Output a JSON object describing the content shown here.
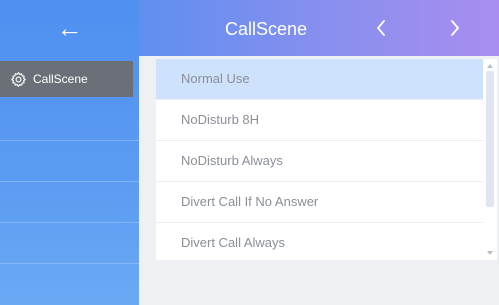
{
  "header": {
    "title": "CallScene",
    "back_glyph": "←",
    "prev_icon": "chevron-left-icon",
    "next_icon": "chevron-right-icon"
  },
  "sidebar": {
    "items": [
      {
        "label": "CallScene",
        "icon": "gear-icon",
        "selected": true
      }
    ]
  },
  "list": {
    "items": [
      {
        "label": "Normal Use",
        "selected": true
      },
      {
        "label": "NoDisturb 8H",
        "selected": false
      },
      {
        "label": "NoDisturb Always",
        "selected": false
      },
      {
        "label": "Divert Call If No Answer",
        "selected": false
      },
      {
        "label": "Divert Call Always",
        "selected": false
      }
    ]
  },
  "colors": {
    "sidebar": "#5a9bf2",
    "header_start": "#5f8ff0",
    "header_end": "#a88ef0",
    "selected_row": "#cfe2fb",
    "selected_side_item": "#6b6f77"
  }
}
